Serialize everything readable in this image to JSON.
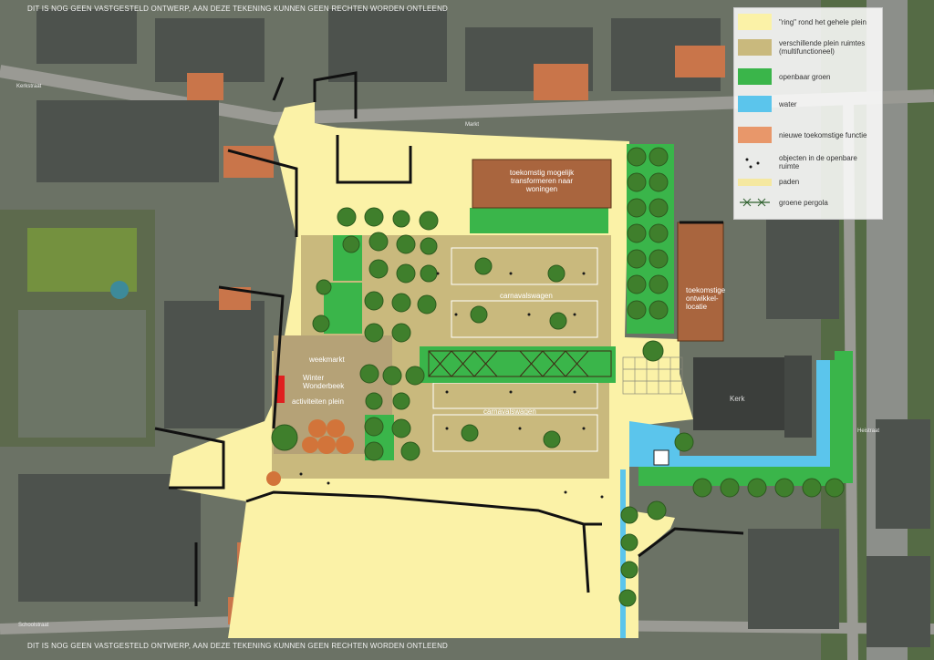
{
  "disclaimer": {
    "top": "DIT IS NOG GEEN VASTGESTELD ONTWERP, AAN DEZE TEKENING KUNNEN GEEN RECHTEN WORDEN ONTLEEND",
    "bottom": "DIT IS NOG GEEN VASTGESTELD ONTWERP, AAN DEZE TEKENING KUNNEN GEEN RECHTEN WORDEN ONTLEEND"
  },
  "legend": {
    "items": [
      {
        "label": "\"ring\" rond het gehele plein",
        "color": "#fbf2a7",
        "kind": "swatch"
      },
      {
        "label": "verschillende plein ruimtes (multifunctioneel)",
        "color": "#c9b97d",
        "kind": "swatch"
      },
      {
        "label": "openbaar groen",
        "color": "#3ab54a",
        "kind": "swatch"
      },
      {
        "label": "water",
        "color": "#5bc5ec",
        "kind": "swatch"
      },
      {
        "label": "nieuwe toekomstige functie",
        "color": "#e8976a",
        "kind": "swatch"
      },
      {
        "label": "objecten in de openbare ruimte",
        "color": "#1a1a1a",
        "kind": "dots"
      },
      {
        "label": "paden",
        "color": "#f5e8a0",
        "kind": "swatch"
      },
      {
        "label": "groene pergola",
        "color": "#2d5f2d",
        "kind": "pergola"
      }
    ]
  },
  "labels": {
    "toekomstig": "toekomstig mogelijk transformeren naar woningen",
    "toekomstige_locatie": "toekomstige ontwikkel- locatie",
    "carnavalswagen_1": "carnavalswagen",
    "carnavalswagen_2": "carnavalswagen",
    "weekmarkt": "weekmarkt",
    "winter": "Winter Wonderbeek",
    "activiteiten": "activiteiten plein",
    "kerk": "Kerk"
  },
  "streets": {
    "s1": "Kerkstraat",
    "s2": "Markt",
    "s3": "Schoolstraat",
    "s4": "Heistraat"
  },
  "colors": {
    "ring": "#fbf2a7",
    "plaza": "#c9b97d",
    "green": "#3ab54a",
    "water": "#5bc5ec",
    "future": "#e8976a",
    "paths": "#f5e8a0"
  }
}
